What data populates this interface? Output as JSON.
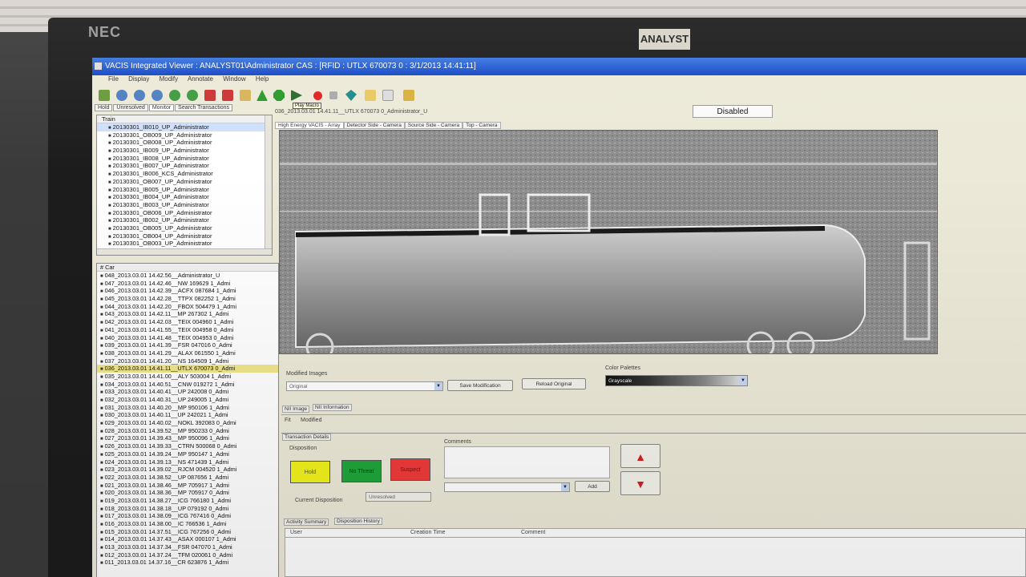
{
  "monitor": {
    "brand": "NEC",
    "sticker": "ANALYST"
  },
  "window": {
    "title": "VACIS Integrated Viewer : ANALYST01\\Administrator CAS : [RFID : UTLX 670073 0 : 3/1/2013 14:41:11]"
  },
  "menu": [
    "File",
    "Display",
    "Modify",
    "Annotate",
    "Window",
    "Help"
  ],
  "toolbar": {
    "tooltip": "Play Macro"
  },
  "left_tabs": [
    "Hold",
    "Unresolved",
    "Monitor",
    "Search Transactions"
  ],
  "train_panel": {
    "header": "Train",
    "items": [
      "20130301_IB010_UP_Administrator",
      "20130301_OB009_UP_Administrator",
      "20130301_OB008_UP_Administrator",
      "20130301_IB009_UP_Administrator",
      "20130301_IB008_UP_Administrator",
      "20130301_IB007_UP_Administrator",
      "20130301_IB006_KCS_Administrator",
      "20130301_OB007_UP_Administrator",
      "20130301_IB005_UP_Administrator",
      "20130301_IB004_UP_Administrator",
      "20130301_IB003_UP_Administrator",
      "20130301_OB006_UP_Administrator",
      "20130301_IB002_UP_Administrator",
      "20130301_OB005_UP_Administrator",
      "20130301_OB004_UP_Administrator",
      "20130301_OB003_UP_Administrator"
    ]
  },
  "car_panel": {
    "header": "# Car",
    "items": [
      "048_2013.03.01 14.42.56__Administrator_U",
      "047_2013.03.01 14.42.46__NW  169629 1_Admi",
      "046_2013.03.01 14.42.39__ACFX 087684 1_Admi",
      "045_2013.03.01 14.42.28__TTPX 082252 1_Admi",
      "044_2013.03.01 14.42.20__FBOX 504479 1_Admi",
      "043_2013.03.01 14.42.11__MP  267302 1_Admi",
      "042_2013.03.01 14.42.03__TEIX 004960 1_Admi",
      "041_2013.03.01 14.41.55__TEIX 004958 0_Admi",
      "040_2013.03.01 14.41.48__TEIX 004953 0_Admi",
      "039_2013.03.01 14.41.39__FSR  047016 0_Admi",
      "038_2013.03.01 14.41.29__ALAX 061550 1_Admi",
      "037_2013.03.01 14.41.20__NS  164509 1_Admi",
      "036_2013.03.01 14.41.11__UTLX 670073 0_Admi",
      "035_2013.03.01 14.41.00__ALY  503004 1_Admi",
      "034_2013.03.01 14.40.51__CNW  019272 1_Admi",
      "033_2013.03.01 14.40.41__UP  242008 0_Admi",
      "032_2013.03.01 14.40.31__UP  249005 1_Admi",
      "031_2013.03.01 14.40.20__MP  950106 1_Admi",
      "030_2013.03.01 14.40.11__UP  242021 1_Admi",
      "029_2013.03.01 14.40.02__NOKL 392083 0_Admi",
      "028_2013.03.01 14.39.52__MP  950233 0_Admi",
      "027_2013.03.01 14.39.43__MP  950096 1_Admi",
      "026_2013.03.01 14.39.33__CTRN 500068 0_Admi",
      "025_2013.03.01 14.39.24__MP  950147 1_Admi",
      "024_2013.03.01 14.39.13__NS  471439 1_Admi",
      "023_2013.03.01 14.39.02__RJCM 004520 1_Admi",
      "022_2013.03.01 14.38.52__UP  087656 1_Admi",
      "021_2013.03.01 14.38.46__MP  705917 1_Admi",
      "020_2013.03.01 14.38.36__MP  705917 0_Admi",
      "019_2013.03.01 14.38.27__ICG  766180 1_Admi",
      "018_2013.03.01 14.38.18__UP  079192 0_Admi",
      "017_2013.03.01 14.38.09__ICG  767416 0_Admi",
      "016_2013.03.01 14.38.00__IC  766536 1_Admi",
      "015_2013.03.01 14.37.51__ICG  767256 0_Admi",
      "014_2013.03.01 14.37.43__ASAX 000107 1_Admi",
      "013_2013.03.01 14.37.34__FSR  047070 1_Admi",
      "012_2013.03.01 14.37.24__TFM  020061 0_Admi",
      "011_2013.03.01 14.37.16__CR  623876 1_Admi"
    ]
  },
  "viewer": {
    "breadcrumb": "036_2013.03.01 14.41.11__UTLX 670073 0_Administrator_U",
    "status": "Disabled",
    "image_tabs": [
      "High Energy VACIS - Array",
      "Detector Side - Camera",
      "Source Side - Camera",
      "Top - Camera"
    ],
    "modified_images_label": "Modified Images",
    "modified_images_value": "Original",
    "save_button": "Save Modification",
    "reload_button": "Reload Original",
    "color_palettes_label": "Color Palettes",
    "color_palettes_value": "Grayscale",
    "nii_tabs": [
      "NII Image",
      "NII Information"
    ],
    "fit_label": "Fit",
    "modified_label": "Modified"
  },
  "transaction": {
    "tab": "Transaction Details",
    "disposition_label": "Disposition",
    "hold": "Hold",
    "resolved": "No Threat",
    "suspect": "Suspect",
    "comments_label": "Comments",
    "add_button": "Add",
    "current_disposition_label": "Current Disposition",
    "current_disposition_value": "Unresolved",
    "bottom_tabs": [
      "Activity Summary",
      "Disposition History"
    ],
    "grid_headers": [
      "User",
      "Creation Time",
      "Comment"
    ]
  },
  "colors": {
    "title_blue": "#1446c4",
    "hold_yellow": "#f2f21c",
    "resolve_green": "#1fa53a",
    "suspect_red": "#f03a3a"
  }
}
